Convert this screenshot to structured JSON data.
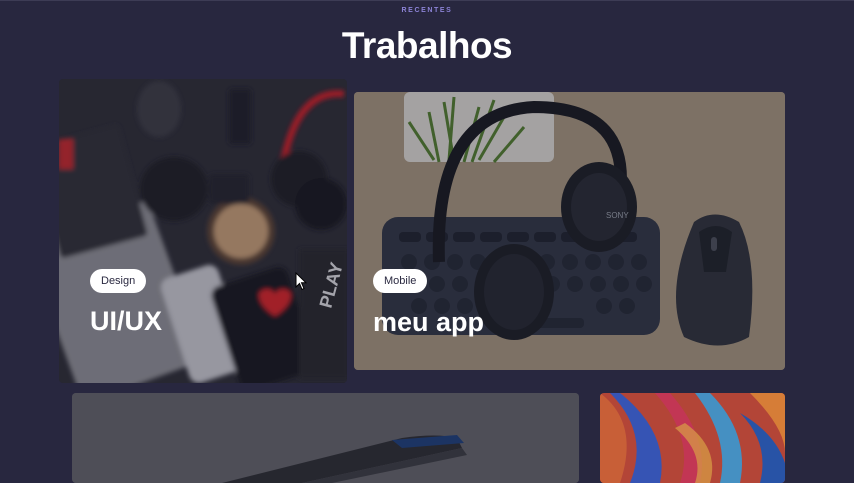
{
  "header": {
    "eyebrow": "RECENTES",
    "title": "Trabalhos"
  },
  "cards": [
    {
      "tag": "Design",
      "title": "UI/UX",
      "image": "dark-desk-flatlay-phone-coffee-mouse"
    },
    {
      "tag": "Mobile",
      "title": "meu app",
      "image": "headphones-keyboard-mouse-plant"
    },
    {
      "image": "laptop-closeup"
    },
    {
      "image": "colorful-abstract-waves"
    }
  ],
  "colors": {
    "background": "#28273f",
    "accent": "#8c83d6",
    "badge_bg": "#ffffff",
    "badge_text": "#2a2940"
  },
  "icons": [
    "mouse-cursor-icon"
  ]
}
